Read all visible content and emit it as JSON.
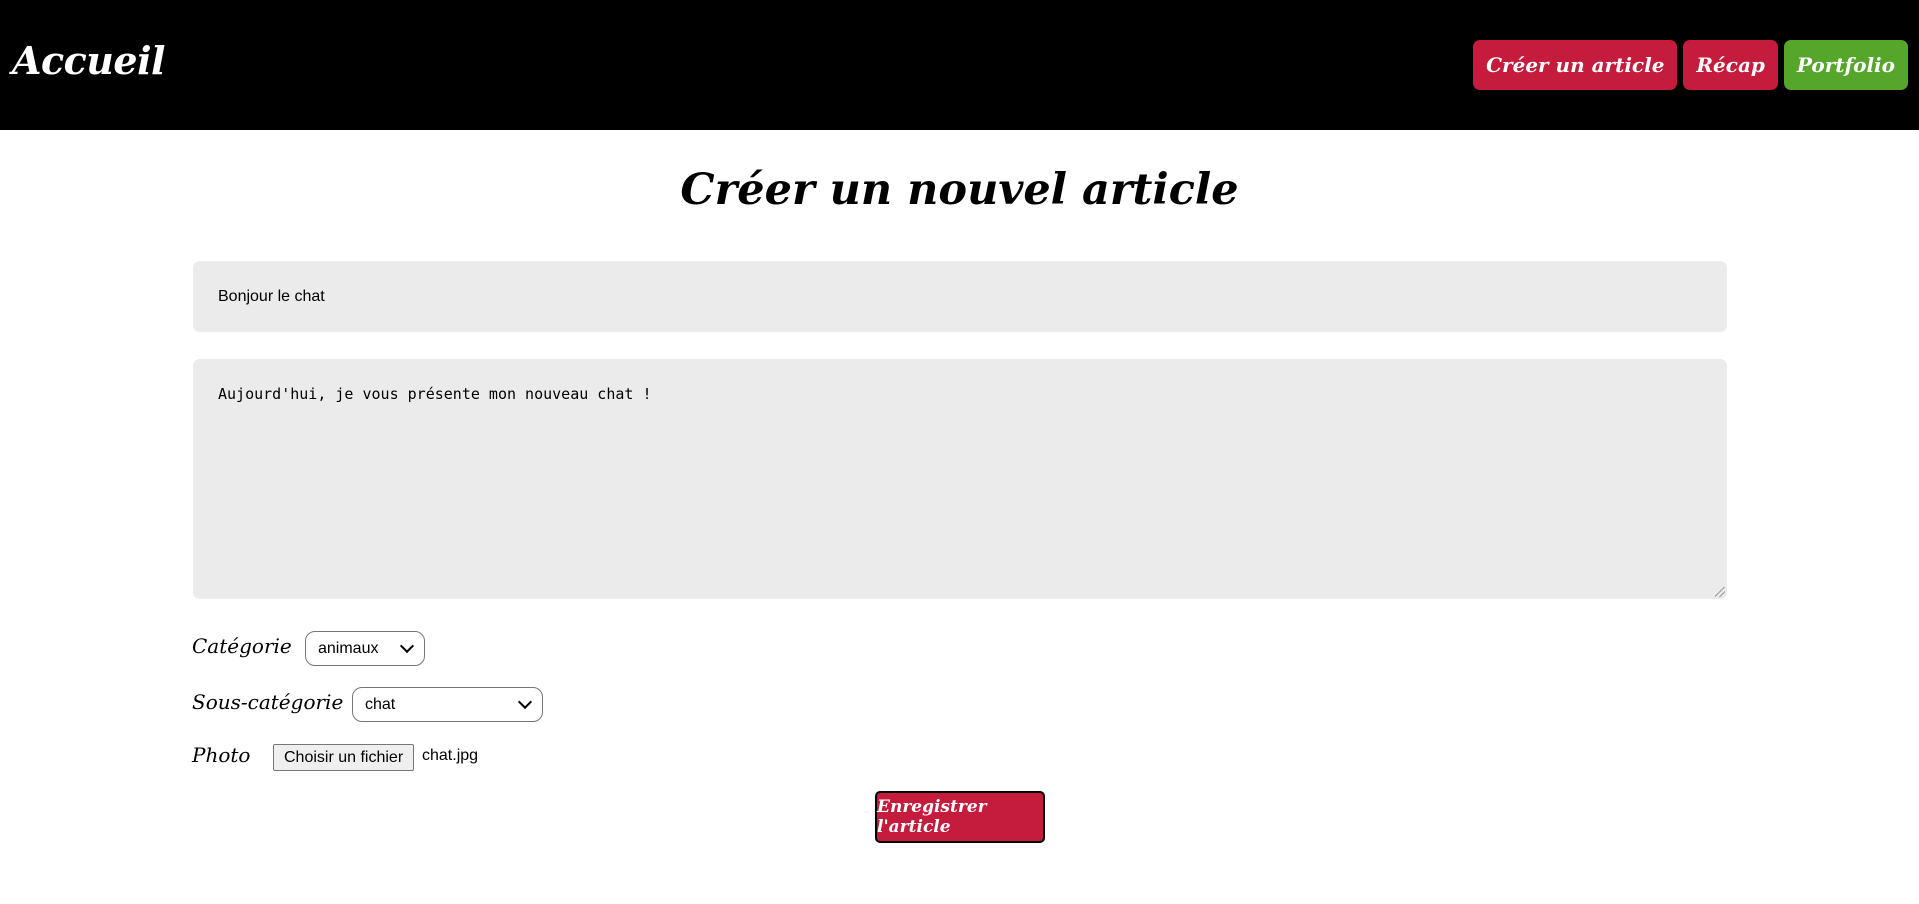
{
  "header": {
    "brand": "Accueil",
    "nav": [
      {
        "label": "Créer un article",
        "color": "#c51b3c"
      },
      {
        "label": "Récap",
        "color": "#c51b3c"
      },
      {
        "label": "Portfolio",
        "color": "#55a62b"
      }
    ]
  },
  "form": {
    "heading": "Créer un nouvel article",
    "title_value": "Bonjour le chat",
    "content_value": "Aujourd'hui, je vous présente mon nouveau chat !",
    "category": {
      "label": "Catégorie",
      "selected": "animaux"
    },
    "subcategory": {
      "label": "Sous-catégorie",
      "selected": "chat"
    },
    "photo": {
      "label": "Photo",
      "button": "Choisir un fichier",
      "file_name": "chat.jpg"
    },
    "submit_label": "Enregistrer l'article"
  },
  "colors": {
    "header_bg": "#000000",
    "accent_red": "#c51b3c",
    "accent_green": "#55a62b",
    "field_bg": "#ebebeb"
  }
}
